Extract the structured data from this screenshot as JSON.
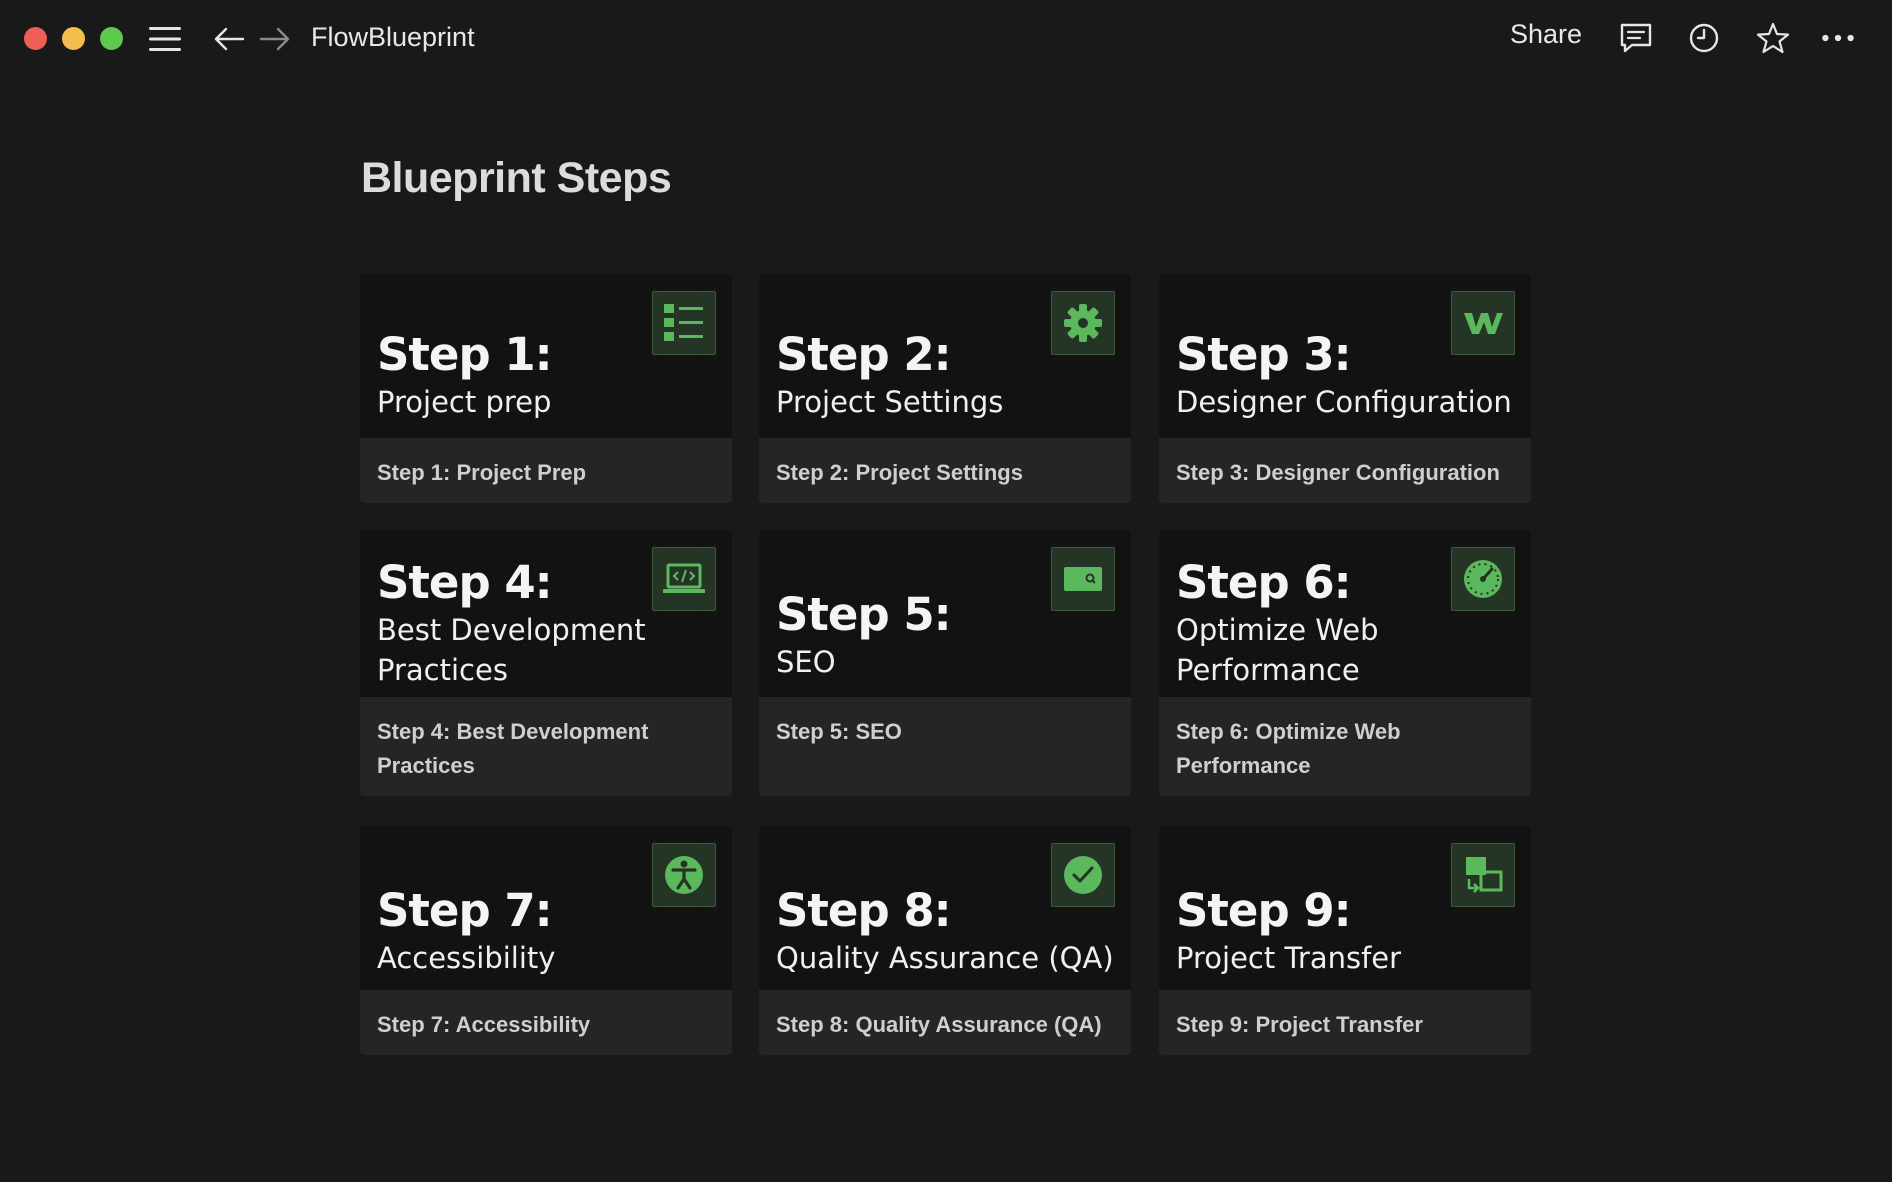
{
  "window": {
    "app_title": "FlowBlueprint",
    "share_label": "Share",
    "icons": [
      "close-button",
      "minimize-button",
      "zoom-button",
      "menu-icon",
      "back-arrow-icon",
      "forward-arrow-icon",
      "comment-icon",
      "history-clock-icon",
      "star-icon",
      "more-dots-icon"
    ]
  },
  "page": {
    "title": "Blueprint Steps"
  },
  "colors": {
    "accent_green": "#5cb85c",
    "background": "#191919",
    "card_caption_bg": "#252525"
  },
  "cards": [
    {
      "step": "Step 1:",
      "subtitle": "Project prep",
      "caption": "Step 1: Project Prep",
      "icon": "checklist-icon"
    },
    {
      "step": "Step 2:",
      "subtitle": "Project Settings",
      "caption": "Step 2: Project Settings",
      "icon": "gear-icon"
    },
    {
      "step": "Step 3:",
      "subtitle": "Designer Configuration",
      "caption": "Step 3: Designer Configuration",
      "icon": "webflow-logo-icon"
    },
    {
      "step": "Step 4:",
      "subtitle": "Best Development Practices",
      "caption": "Step 4: Best Development Practices",
      "icon": "code-laptop-icon"
    },
    {
      "step": "Step 5:",
      "subtitle": "SEO",
      "caption": "Step 5: SEO",
      "icon": "search-window-icon"
    },
    {
      "step": "Step 6:",
      "subtitle": "Optimize Web Performance",
      "caption": "Step 6: Optimize Web Performance",
      "icon": "speedometer-icon"
    },
    {
      "step": "Step 7:",
      "subtitle": "Accessibility",
      "caption": "Step 7: Accessibility",
      "icon": "accessibility-icon"
    },
    {
      "step": "Step 8:",
      "subtitle": "Quality Assurance (QA)",
      "caption": "Step 8: Quality Assurance (QA)",
      "icon": "check-badge-icon"
    },
    {
      "step": "Step 9:",
      "subtitle": "Project Transfer",
      "caption": "Step 9: Project Transfer",
      "icon": "transfer-icon"
    }
  ]
}
